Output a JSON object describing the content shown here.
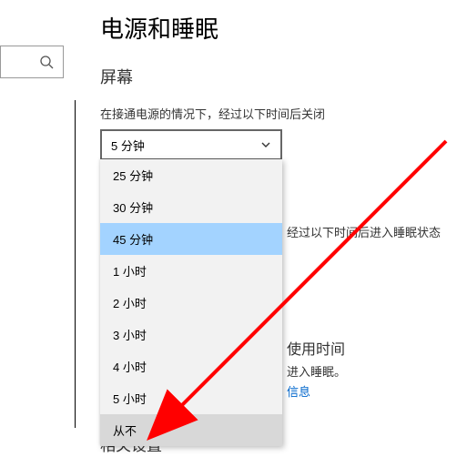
{
  "page_title": "电源和睡眠",
  "screen_section": "屏幕",
  "screen_off_label": "在接通电源的情况下，经过以下时间后关闭",
  "screen_off_value": "5 分钟",
  "dropdown_items": [
    {
      "label": "25 分钟",
      "state": ""
    },
    {
      "label": "30 分钟",
      "state": ""
    },
    {
      "label": "45 分钟",
      "state": "selected"
    },
    {
      "label": "1 小时",
      "state": ""
    },
    {
      "label": "2 小时",
      "state": ""
    },
    {
      "label": "3 小时",
      "state": ""
    },
    {
      "label": "4 小时",
      "state": ""
    },
    {
      "label": "5 小时",
      "state": ""
    },
    {
      "label": "从不",
      "state": "hover"
    }
  ],
  "behind_sleep_label": "经过以下时间后进入睡眠状态",
  "behind_usage_title": "使用时间",
  "behind_usage_sub": "进入睡眠。",
  "behind_link": "信息",
  "related_title": "相关设置",
  "colors": {
    "highlight": "#a3d3ff",
    "hover": "#d8d8d8",
    "link": "#0066cc",
    "arrow": "#ff0000"
  }
}
